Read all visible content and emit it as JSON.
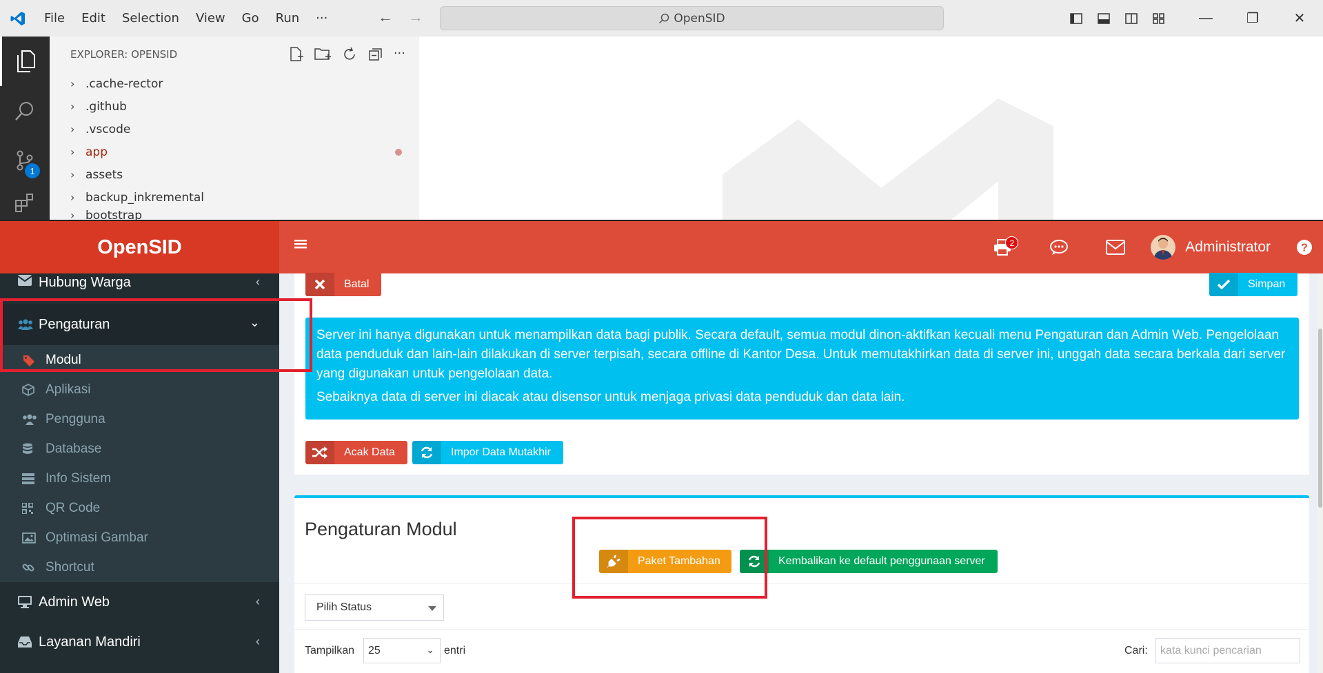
{
  "vscode": {
    "menu": [
      "File",
      "Edit",
      "Selection",
      "View",
      "Go",
      "Run"
    ],
    "more": "···",
    "search": "OpenSID",
    "explorer_title": "EXPLORER: OPENSID",
    "tree": [
      ".cache-rector",
      ".github",
      ".vscode",
      "app",
      "assets",
      "backup_inkremental",
      "bootstrap"
    ],
    "scm_badge": "1"
  },
  "opensid": {
    "brand": "OpenSID",
    "notif_count": "2",
    "user_name": "Administrator",
    "sidebar": {
      "hubung_warga": "Hubung Warga",
      "pengaturan": "Pengaturan",
      "sub": [
        "Modul",
        "Aplikasi",
        "Pengguna",
        "Database",
        "Info Sistem",
        "QR Code",
        "Optimasi Gambar",
        "Shortcut"
      ],
      "admin_web": "Admin Web",
      "layanan_mandiri": "Layanan Mandiri"
    },
    "buttons": {
      "batal": "Batal",
      "simpan": "Simpan",
      "acak_data": "Acak Data",
      "impor": "Impor Data Mutakhir",
      "paket_tambahan": "Paket Tambahan",
      "kembalikan": "Kembalikan ke default penggunaan server"
    },
    "callout": {
      "p1": "Server ini hanya digunakan untuk menampilkan data bagi publik. Secara default, semua modul dinon-aktifkan kecuali menu Pengaturan dan Admin Web. Pengelolaan data penduduk dan lain-lain dilakukan di server terpisah, secara offline di Kantor Desa. Untuk memutakhirkan data di server ini, unggah data secara berkala dari server yang digunakan untuk pengelolaan data.",
      "p2": "Sebaiknya data di server ini diacak atau disensor untuk menjaga privasi data penduduk dan data lain."
    },
    "modul_title": "Pengaturan Modul",
    "status_select": "Pilih Status",
    "show_label": "Tampilkan",
    "show_value": "25",
    "entries_label": "entri",
    "search_label": "Cari:",
    "search_placeholder": "kata kunci pencarian"
  },
  "colors": {
    "header_red": "#dd4b39",
    "brand_red": "#d73925",
    "sidebar": "#222d32",
    "info": "#00c0ef",
    "success": "#00a65a",
    "warning": "#f39c12",
    "highlight": "#e3202f"
  }
}
